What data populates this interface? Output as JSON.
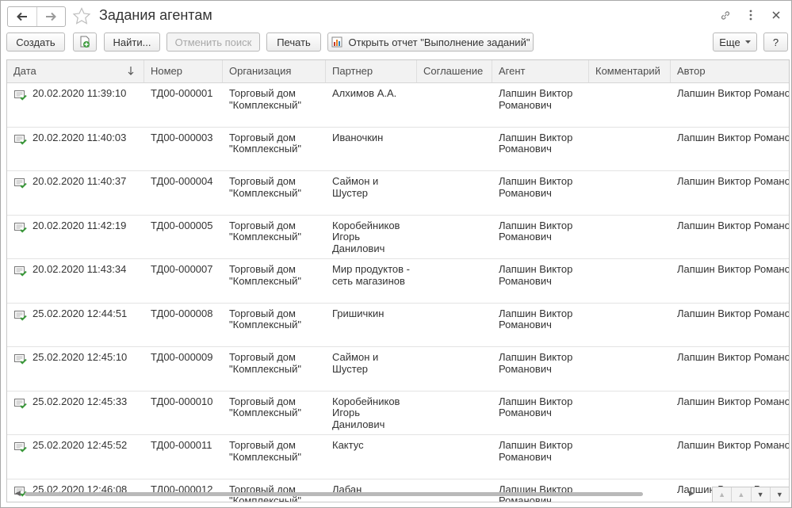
{
  "window": {
    "title": "Задания агентам",
    "icons": [
      "link-icon",
      "more-vertical-icon",
      "close-icon"
    ]
  },
  "toolbar": {
    "create": "Создать",
    "find": "Найти...",
    "cancel_search": "Отменить поиск",
    "print": "Печать",
    "open_report": "Открыть отчет \"Выполнение заданий\"",
    "more": "Еще",
    "help": "?"
  },
  "table": {
    "columns": [
      "Дата",
      "Номер",
      "Организация",
      "Партнер",
      "Соглашение",
      "Агент",
      "Комментарий",
      "Автор"
    ],
    "sort_column": "Дата",
    "rows": [
      {
        "date": "20.02.2020 11:39:10",
        "number": "ТД00-000001",
        "org": "Торговый дом\n\"Комплексный\"",
        "partner": "Алхимов А.А.",
        "agreement": "",
        "agent": "Лапшин Виктор\nРоманович",
        "comment": "",
        "author": "Лапшин Виктор Романович"
      },
      {
        "date": "20.02.2020 11:40:03",
        "number": "ТД00-000003",
        "org": "Торговый дом\n\"Комплексный\"",
        "partner": "Иваночкин",
        "agreement": "",
        "agent": "Лапшин Виктор\nРоманович",
        "comment": "",
        "author": "Лапшин Виктор Романович"
      },
      {
        "date": "20.02.2020 11:40:37",
        "number": "ТД00-000004",
        "org": "Торговый дом\n\"Комплексный\"",
        "partner": "Саймон и\nШустер",
        "agreement": "",
        "agent": "Лапшин Виктор\nРоманович",
        "comment": "",
        "author": "Лапшин Виктор Романович"
      },
      {
        "date": "20.02.2020 11:42:19",
        "number": "ТД00-000005",
        "org": "Торговый дом\n\"Комплексный\"",
        "partner": "Коробейников\nИгорь\nДанилович",
        "agreement": "",
        "agent": "Лапшин Виктор\nРоманович",
        "comment": "",
        "author": "Лапшин Виктор Романович"
      },
      {
        "date": "20.02.2020 11:43:34",
        "number": "ТД00-000007",
        "org": "Торговый дом\n\"Комплексный\"",
        "partner": "Мир продуктов -\nсеть магазинов",
        "agreement": "",
        "agent": "Лапшин Виктор\nРоманович",
        "comment": "",
        "author": "Лапшин Виктор Романович"
      },
      {
        "date": "25.02.2020 12:44:51",
        "number": "ТД00-000008",
        "org": "Торговый дом\n\"Комплексный\"",
        "partner": "Гришичкин",
        "agreement": "",
        "agent": "Лапшин Виктор\nРоманович",
        "comment": "",
        "author": "Лапшин Виктор Романович"
      },
      {
        "date": "25.02.2020 12:45:10",
        "number": "ТД00-000009",
        "org": "Торговый дом\n\"Комплексный\"",
        "partner": "Саймон и\nШустер",
        "agreement": "",
        "agent": "Лапшин Виктор\nРоманович",
        "comment": "",
        "author": "Лапшин Виктор Романович"
      },
      {
        "date": "25.02.2020 12:45:33",
        "number": "ТД00-000010",
        "org": "Торговый дом\n\"Комплексный\"",
        "partner": "Коробейников\nИгорь\nДанилович",
        "agreement": "",
        "agent": "Лапшин Виктор\nРоманович",
        "comment": "",
        "author": "Лапшин Виктор Романович"
      },
      {
        "date": "25.02.2020 12:45:52",
        "number": "ТД00-000011",
        "org": "Торговый дом\n\"Комплексный\"",
        "partner": "Кактус",
        "agreement": "",
        "agent": "Лапшин Виктор\nРоманович",
        "comment": "",
        "author": "Лапшин Виктор Романович"
      },
      {
        "date": "25.02.2020 12:46:08",
        "number": "ТД00-000012",
        "org": "Торговый дом\n\"Комплексный\"",
        "partner": "Лабан",
        "agreement": "",
        "agent": "Лапшин Виктор\nРоманович",
        "comment": "",
        "author": "Лапшин Виктор Романович"
      }
    ]
  },
  "colors": {
    "accent_green": "#3a9a3a",
    "border": "#b9b9b9",
    "header_bg": "#f2f2f2"
  }
}
